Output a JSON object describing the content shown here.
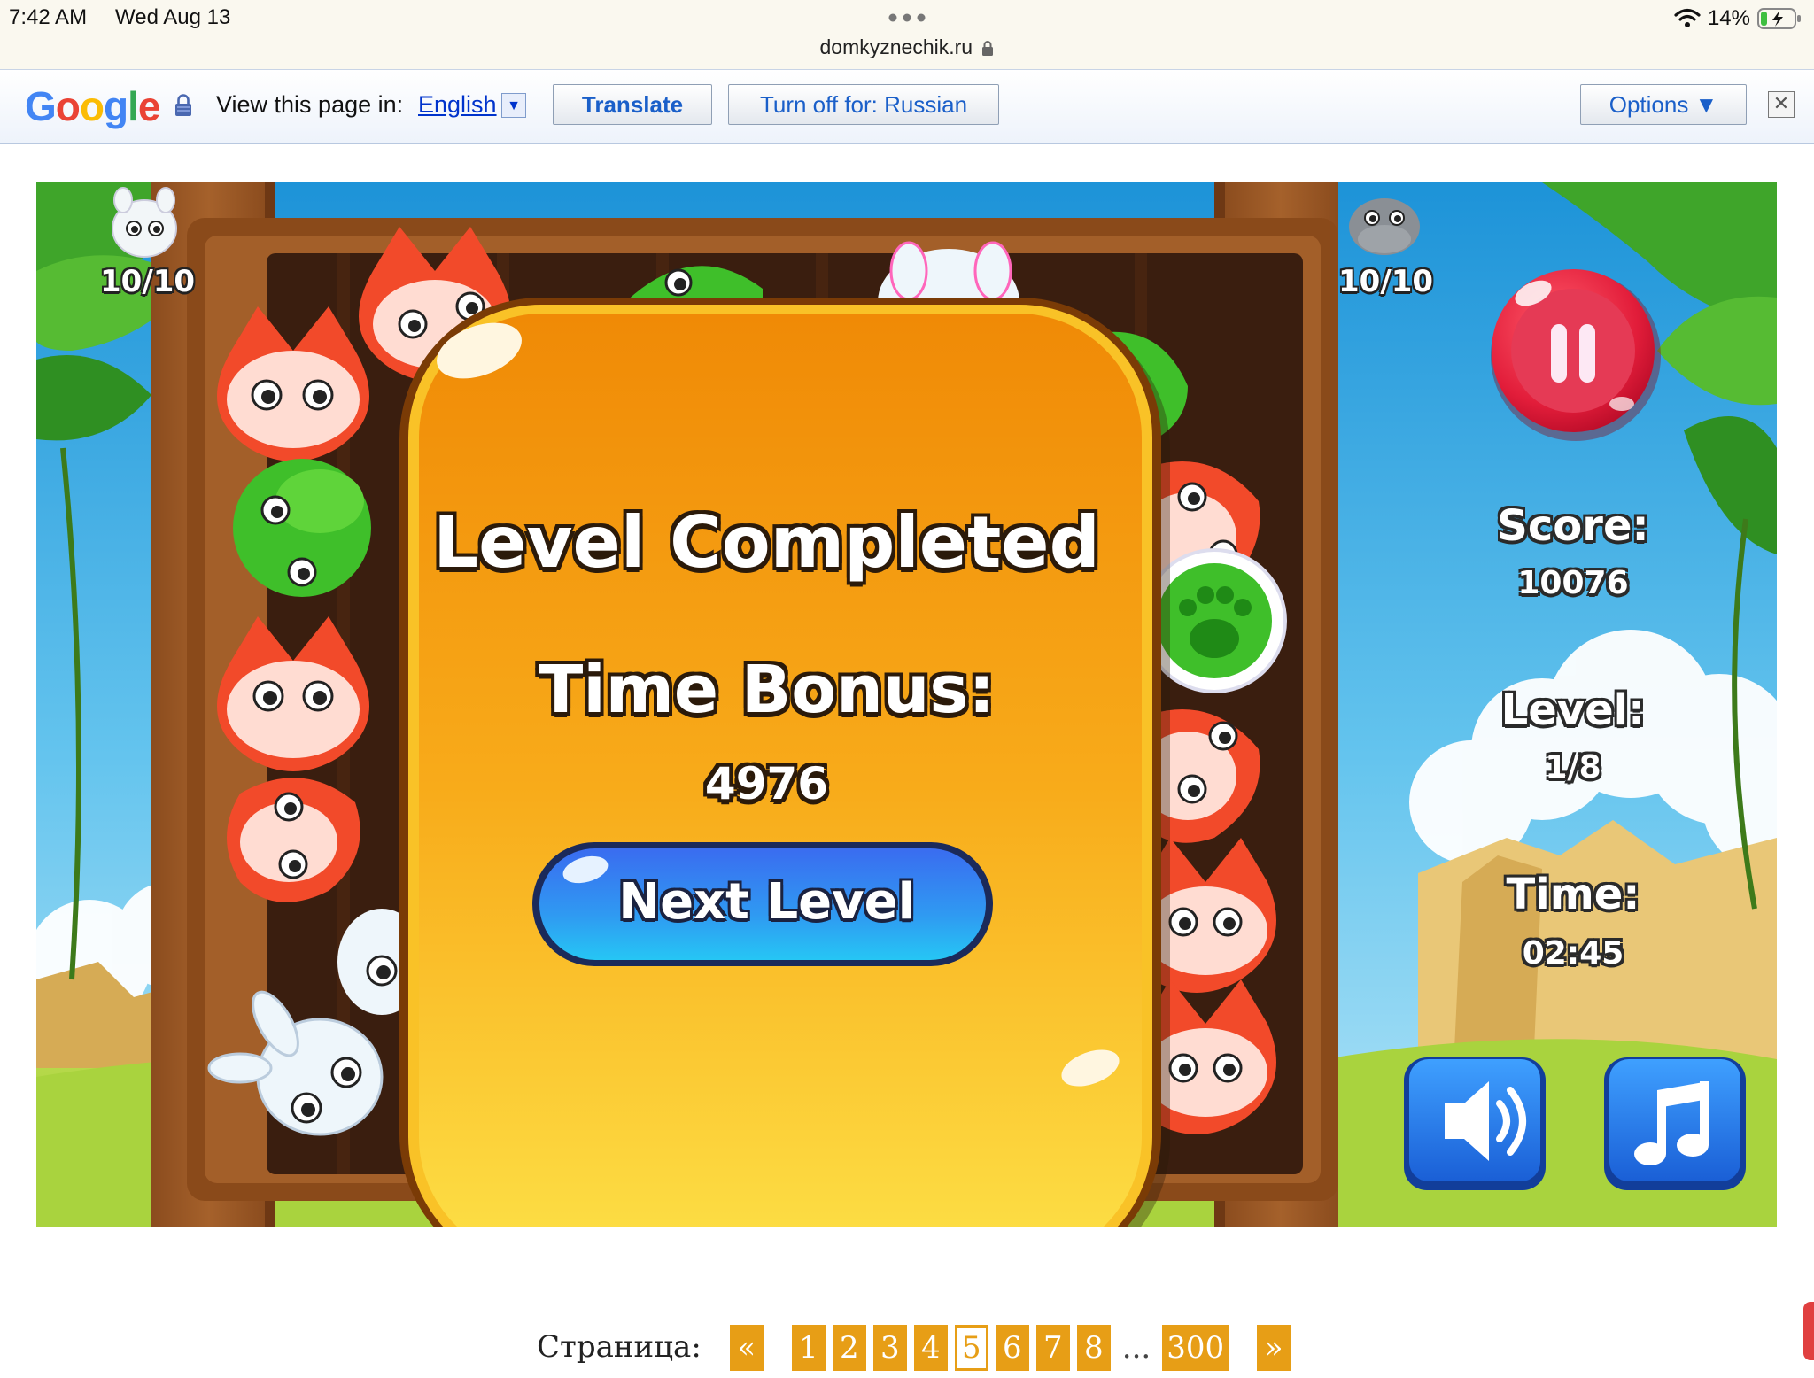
{
  "status_bar": {
    "time": "7:42 AM",
    "date": "Wed Aug 13",
    "url": "domkyznechik.ru",
    "battery": "14%"
  },
  "translate_bar": {
    "logo": "Google",
    "label": "View this page in:",
    "language": "English",
    "translate_button": "Translate",
    "turn_off_button": "Turn off for: Russian",
    "options_button": "Options ▼"
  },
  "game": {
    "left_counter": "10/10",
    "right_counter": "10/10",
    "hud": {
      "score_label": "Score:",
      "score_value": "10076",
      "level_label": "Level:",
      "level_value": "1/8",
      "time_label": "Time:",
      "time_value": "02:45"
    },
    "popup": {
      "title": "Level Completed",
      "bonus_label": "Time Bonus:",
      "bonus_value": "4976",
      "next_button": "Next Level"
    }
  },
  "pagination": {
    "label": "Страница:",
    "prev": "«",
    "pages": [
      "1",
      "2",
      "3",
      "4",
      "5",
      "6",
      "7",
      "8"
    ],
    "active_page": "5",
    "ellipsis": "...",
    "last_page": "300",
    "next": "»"
  }
}
